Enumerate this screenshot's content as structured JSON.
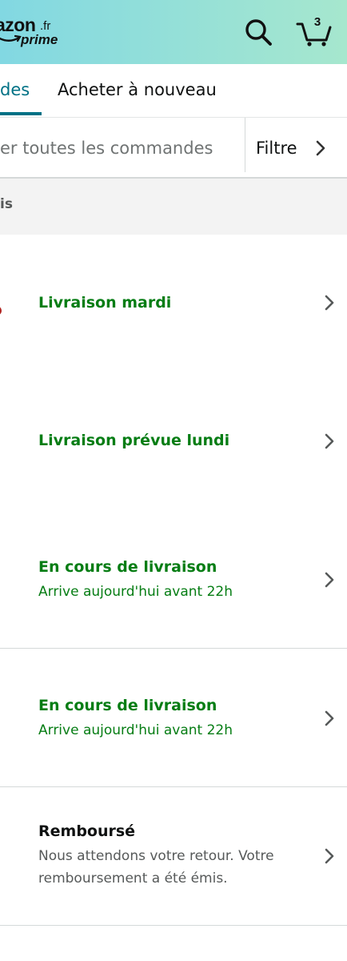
{
  "header": {
    "logo_main": "azon",
    "logo_tld": ".fr",
    "logo_prime": "prime",
    "cart_count": "3",
    "search_icon": "search-icon",
    "cart_icon": "cart-icon",
    "gradient_start": "#82d8e2",
    "gradient_end": "#a6e7ce"
  },
  "tabs": [
    {
      "label": "des",
      "active": true
    },
    {
      "label": "Acheter à nouveau",
      "active": false
    }
  ],
  "search": {
    "placeholder": "er toutes les commandes",
    "filter_label": "Filtre",
    "filter_icon": "chevron-right-icon"
  },
  "section": {
    "label": "is"
  },
  "orders": [
    {
      "title": "Livraison mardi",
      "subtitle": "",
      "title_color": "#067d14"
    },
    {
      "title": "Livraison prévue lundi",
      "subtitle": "",
      "title_color": "#067d14"
    },
    {
      "title": "En cours de livraison",
      "subtitle": "Arrive aujourd'hui avant 22h",
      "title_color": "#067d14"
    },
    {
      "title": "En cours de livraison",
      "subtitle": "Arrive aujourd'hui avant 22h",
      "title_color": "#067d14"
    },
    {
      "title": "Remboursé",
      "subtitle": "Nous attendons votre retour. Votre remboursement a été émis.",
      "title_color": "#0f1111"
    }
  ],
  "colors": {
    "accent": "#007185",
    "status_green": "#067d14",
    "text": "#0f1111",
    "muted": "#565959"
  }
}
